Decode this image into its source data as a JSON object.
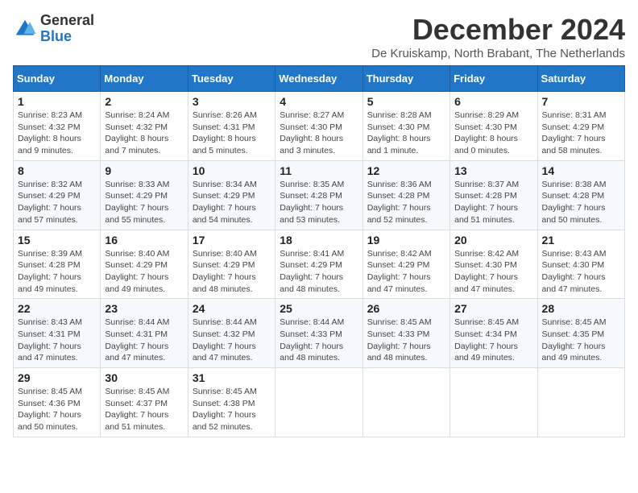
{
  "logo": {
    "general": "General",
    "blue": "Blue"
  },
  "header": {
    "month_title": "December 2024",
    "subtitle": "De Kruiskamp, North Brabant, The Netherlands"
  },
  "days_of_week": [
    "Sunday",
    "Monday",
    "Tuesday",
    "Wednesday",
    "Thursday",
    "Friday",
    "Saturday"
  ],
  "weeks": [
    [
      {
        "day": "1",
        "sunrise": "8:23 AM",
        "sunset": "4:32 PM",
        "daylight": "8 hours and 9 minutes."
      },
      {
        "day": "2",
        "sunrise": "8:24 AM",
        "sunset": "4:32 PM",
        "daylight": "8 hours and 7 minutes."
      },
      {
        "day": "3",
        "sunrise": "8:26 AM",
        "sunset": "4:31 PM",
        "daylight": "8 hours and 5 minutes."
      },
      {
        "day": "4",
        "sunrise": "8:27 AM",
        "sunset": "4:30 PM",
        "daylight": "8 hours and 3 minutes."
      },
      {
        "day": "5",
        "sunrise": "8:28 AM",
        "sunset": "4:30 PM",
        "daylight": "8 hours and 1 minute."
      },
      {
        "day": "6",
        "sunrise": "8:29 AM",
        "sunset": "4:30 PM",
        "daylight": "8 hours and 0 minutes."
      },
      {
        "day": "7",
        "sunrise": "8:31 AM",
        "sunset": "4:29 PM",
        "daylight": "7 hours and 58 minutes."
      }
    ],
    [
      {
        "day": "8",
        "sunrise": "8:32 AM",
        "sunset": "4:29 PM",
        "daylight": "7 hours and 57 minutes."
      },
      {
        "day": "9",
        "sunrise": "8:33 AM",
        "sunset": "4:29 PM",
        "daylight": "7 hours and 55 minutes."
      },
      {
        "day": "10",
        "sunrise": "8:34 AM",
        "sunset": "4:29 PM",
        "daylight": "7 hours and 54 minutes."
      },
      {
        "day": "11",
        "sunrise": "8:35 AM",
        "sunset": "4:28 PM",
        "daylight": "7 hours and 53 minutes."
      },
      {
        "day": "12",
        "sunrise": "8:36 AM",
        "sunset": "4:28 PM",
        "daylight": "7 hours and 52 minutes."
      },
      {
        "day": "13",
        "sunrise": "8:37 AM",
        "sunset": "4:28 PM",
        "daylight": "7 hours and 51 minutes."
      },
      {
        "day": "14",
        "sunrise": "8:38 AM",
        "sunset": "4:28 PM",
        "daylight": "7 hours and 50 minutes."
      }
    ],
    [
      {
        "day": "15",
        "sunrise": "8:39 AM",
        "sunset": "4:28 PM",
        "daylight": "7 hours and 49 minutes."
      },
      {
        "day": "16",
        "sunrise": "8:40 AM",
        "sunset": "4:29 PM",
        "daylight": "7 hours and 49 minutes."
      },
      {
        "day": "17",
        "sunrise": "8:40 AM",
        "sunset": "4:29 PM",
        "daylight": "7 hours and 48 minutes."
      },
      {
        "day": "18",
        "sunrise": "8:41 AM",
        "sunset": "4:29 PM",
        "daylight": "7 hours and 48 minutes."
      },
      {
        "day": "19",
        "sunrise": "8:42 AM",
        "sunset": "4:29 PM",
        "daylight": "7 hours and 47 minutes."
      },
      {
        "day": "20",
        "sunrise": "8:42 AM",
        "sunset": "4:30 PM",
        "daylight": "7 hours and 47 minutes."
      },
      {
        "day": "21",
        "sunrise": "8:43 AM",
        "sunset": "4:30 PM",
        "daylight": "7 hours and 47 minutes."
      }
    ],
    [
      {
        "day": "22",
        "sunrise": "8:43 AM",
        "sunset": "4:31 PM",
        "daylight": "7 hours and 47 minutes."
      },
      {
        "day": "23",
        "sunrise": "8:44 AM",
        "sunset": "4:31 PM",
        "daylight": "7 hours and 47 minutes."
      },
      {
        "day": "24",
        "sunrise": "8:44 AM",
        "sunset": "4:32 PM",
        "daylight": "7 hours and 47 minutes."
      },
      {
        "day": "25",
        "sunrise": "8:44 AM",
        "sunset": "4:33 PM",
        "daylight": "7 hours and 48 minutes."
      },
      {
        "day": "26",
        "sunrise": "8:45 AM",
        "sunset": "4:33 PM",
        "daylight": "7 hours and 48 minutes."
      },
      {
        "day": "27",
        "sunrise": "8:45 AM",
        "sunset": "4:34 PM",
        "daylight": "7 hours and 49 minutes."
      },
      {
        "day": "28",
        "sunrise": "8:45 AM",
        "sunset": "4:35 PM",
        "daylight": "7 hours and 49 minutes."
      }
    ],
    [
      {
        "day": "29",
        "sunrise": "8:45 AM",
        "sunset": "4:36 PM",
        "daylight": "7 hours and 50 minutes."
      },
      {
        "day": "30",
        "sunrise": "8:45 AM",
        "sunset": "4:37 PM",
        "daylight": "7 hours and 51 minutes."
      },
      {
        "day": "31",
        "sunrise": "8:45 AM",
        "sunset": "4:38 PM",
        "daylight": "7 hours and 52 minutes."
      },
      null,
      null,
      null,
      null
    ]
  ]
}
